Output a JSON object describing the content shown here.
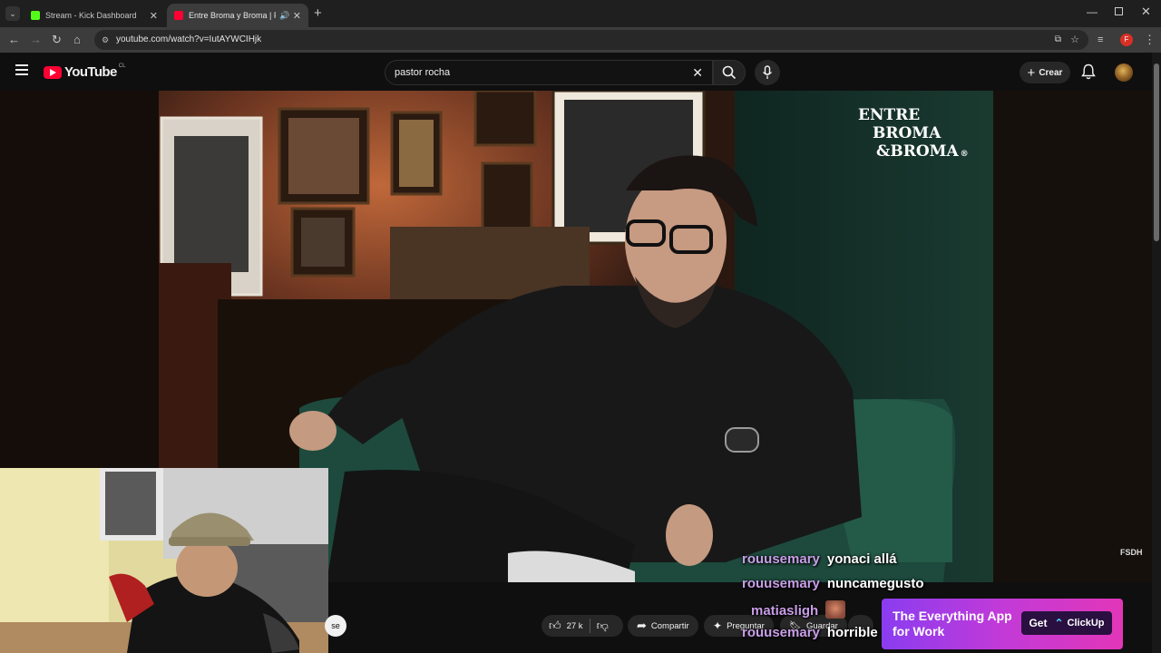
{
  "browser": {
    "tabs": [
      {
        "title": "Stream - Kick Dashboard",
        "active": false,
        "favicon_color": "#53fc18"
      },
      {
        "title": "Entre Broma y Broma | Pastor",
        "active": true,
        "favicon_color": "#ff0033"
      }
    ],
    "url": "youtube.com/watch?v=IutAYWCIHjk",
    "profile_initial": "F"
  },
  "youtube": {
    "logo_text": "YouTube",
    "country_code": "CL",
    "search_value": "pastor rocha",
    "create_label": "Crear"
  },
  "video": {
    "show_logo": [
      "ENTRE",
      "BROMA",
      "&BROMA"
    ],
    "watermark": "FSDH"
  },
  "actions": {
    "likes": "27 k",
    "share": "Compartir",
    "ask": "Preguntar",
    "save": "Guardar"
  },
  "chat": [
    {
      "user": "rouusemary",
      "message": "yonaci allá"
    },
    {
      "user": "rouusemary",
      "message": "nuncamegusto"
    },
    {
      "user": "matiasligh",
      "message": ""
    },
    {
      "user": "rouusemary",
      "message": "horrible"
    }
  ],
  "ad": {
    "line1": "The Everything App",
    "line2": "for Work",
    "cta_prefix": "Get",
    "brand": "ClickUp"
  },
  "colors": {
    "youtube_red": "#ff0033",
    "kick_green": "#53fc18",
    "chat_username": "#c89ee8"
  }
}
